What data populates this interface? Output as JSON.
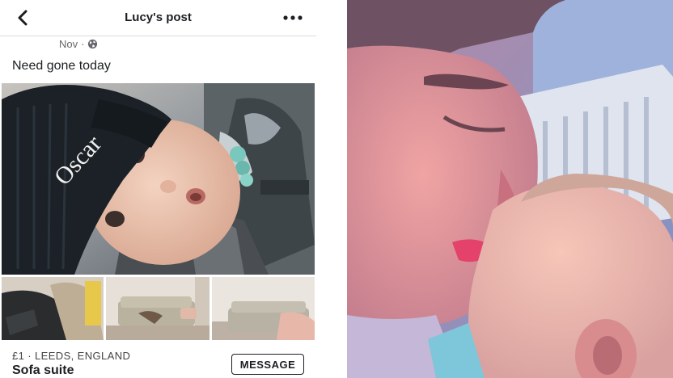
{
  "header": {
    "title": "Lucy's post",
    "back_icon": "chevron-left-icon",
    "more_icon": "more-horizontal-icon"
  },
  "post": {
    "date": "Nov",
    "separator": "·",
    "privacy_icon": "globe-icon",
    "text": "Need gone today"
  },
  "photos": {
    "main": "baby-in-oscar-beanie-photo",
    "thumbnails": [
      "car-seat-photo",
      "sofa-living-room-photo",
      "sofa-closeup-photo"
    ],
    "beanie_text": "Oscar"
  },
  "listing": {
    "price_location": "£1 · LEEDS, ENGLAND",
    "title": "Sofa suite",
    "message_label": "MESSAGE"
  },
  "right_photo": "mother-kissing-baby-photo",
  "colors": {
    "text_primary": "#1c1e21",
    "text_secondary": "#65676b",
    "divider": "#dcdcdc"
  }
}
